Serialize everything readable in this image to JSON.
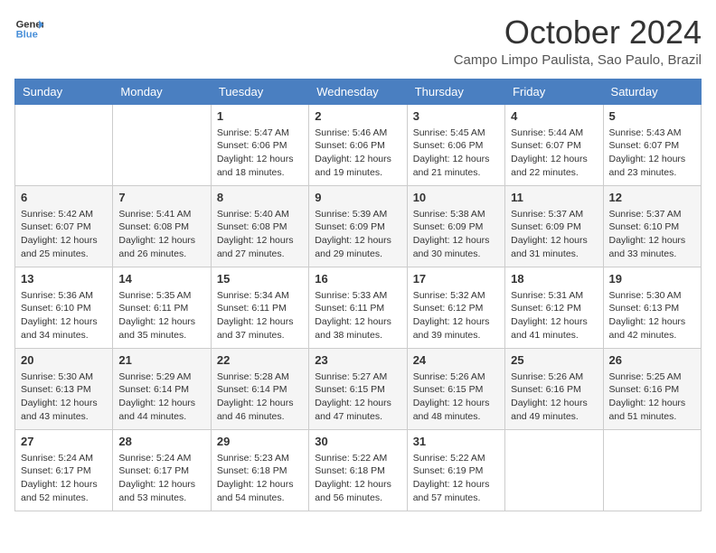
{
  "logo": {
    "line1": "General",
    "line2": "Blue"
  },
  "title": "October 2024",
  "location": "Campo Limpo Paulista, Sao Paulo, Brazil",
  "headers": [
    "Sunday",
    "Monday",
    "Tuesday",
    "Wednesday",
    "Thursday",
    "Friday",
    "Saturday"
  ],
  "weeks": [
    [
      {
        "day": "",
        "content": ""
      },
      {
        "day": "",
        "content": ""
      },
      {
        "day": "1",
        "content": "Sunrise: 5:47 AM\nSunset: 6:06 PM\nDaylight: 12 hours and 18 minutes."
      },
      {
        "day": "2",
        "content": "Sunrise: 5:46 AM\nSunset: 6:06 PM\nDaylight: 12 hours and 19 minutes."
      },
      {
        "day": "3",
        "content": "Sunrise: 5:45 AM\nSunset: 6:06 PM\nDaylight: 12 hours and 21 minutes."
      },
      {
        "day": "4",
        "content": "Sunrise: 5:44 AM\nSunset: 6:07 PM\nDaylight: 12 hours and 22 minutes."
      },
      {
        "day": "5",
        "content": "Sunrise: 5:43 AM\nSunset: 6:07 PM\nDaylight: 12 hours and 23 minutes."
      }
    ],
    [
      {
        "day": "6",
        "content": "Sunrise: 5:42 AM\nSunset: 6:07 PM\nDaylight: 12 hours and 25 minutes."
      },
      {
        "day": "7",
        "content": "Sunrise: 5:41 AM\nSunset: 6:08 PM\nDaylight: 12 hours and 26 minutes."
      },
      {
        "day": "8",
        "content": "Sunrise: 5:40 AM\nSunset: 6:08 PM\nDaylight: 12 hours and 27 minutes."
      },
      {
        "day": "9",
        "content": "Sunrise: 5:39 AM\nSunset: 6:09 PM\nDaylight: 12 hours and 29 minutes."
      },
      {
        "day": "10",
        "content": "Sunrise: 5:38 AM\nSunset: 6:09 PM\nDaylight: 12 hours and 30 minutes."
      },
      {
        "day": "11",
        "content": "Sunrise: 5:37 AM\nSunset: 6:09 PM\nDaylight: 12 hours and 31 minutes."
      },
      {
        "day": "12",
        "content": "Sunrise: 5:37 AM\nSunset: 6:10 PM\nDaylight: 12 hours and 33 minutes."
      }
    ],
    [
      {
        "day": "13",
        "content": "Sunrise: 5:36 AM\nSunset: 6:10 PM\nDaylight: 12 hours and 34 minutes."
      },
      {
        "day": "14",
        "content": "Sunrise: 5:35 AM\nSunset: 6:11 PM\nDaylight: 12 hours and 35 minutes."
      },
      {
        "day": "15",
        "content": "Sunrise: 5:34 AM\nSunset: 6:11 PM\nDaylight: 12 hours and 37 minutes."
      },
      {
        "day": "16",
        "content": "Sunrise: 5:33 AM\nSunset: 6:11 PM\nDaylight: 12 hours and 38 minutes."
      },
      {
        "day": "17",
        "content": "Sunrise: 5:32 AM\nSunset: 6:12 PM\nDaylight: 12 hours and 39 minutes."
      },
      {
        "day": "18",
        "content": "Sunrise: 5:31 AM\nSunset: 6:12 PM\nDaylight: 12 hours and 41 minutes."
      },
      {
        "day": "19",
        "content": "Sunrise: 5:30 AM\nSunset: 6:13 PM\nDaylight: 12 hours and 42 minutes."
      }
    ],
    [
      {
        "day": "20",
        "content": "Sunrise: 5:30 AM\nSunset: 6:13 PM\nDaylight: 12 hours and 43 minutes."
      },
      {
        "day": "21",
        "content": "Sunrise: 5:29 AM\nSunset: 6:14 PM\nDaylight: 12 hours and 44 minutes."
      },
      {
        "day": "22",
        "content": "Sunrise: 5:28 AM\nSunset: 6:14 PM\nDaylight: 12 hours and 46 minutes."
      },
      {
        "day": "23",
        "content": "Sunrise: 5:27 AM\nSunset: 6:15 PM\nDaylight: 12 hours and 47 minutes."
      },
      {
        "day": "24",
        "content": "Sunrise: 5:26 AM\nSunset: 6:15 PM\nDaylight: 12 hours and 48 minutes."
      },
      {
        "day": "25",
        "content": "Sunrise: 5:26 AM\nSunset: 6:16 PM\nDaylight: 12 hours and 49 minutes."
      },
      {
        "day": "26",
        "content": "Sunrise: 5:25 AM\nSunset: 6:16 PM\nDaylight: 12 hours and 51 minutes."
      }
    ],
    [
      {
        "day": "27",
        "content": "Sunrise: 5:24 AM\nSunset: 6:17 PM\nDaylight: 12 hours and 52 minutes."
      },
      {
        "day": "28",
        "content": "Sunrise: 5:24 AM\nSunset: 6:17 PM\nDaylight: 12 hours and 53 minutes."
      },
      {
        "day": "29",
        "content": "Sunrise: 5:23 AM\nSunset: 6:18 PM\nDaylight: 12 hours and 54 minutes."
      },
      {
        "day": "30",
        "content": "Sunrise: 5:22 AM\nSunset: 6:18 PM\nDaylight: 12 hours and 56 minutes."
      },
      {
        "day": "31",
        "content": "Sunrise: 5:22 AM\nSunset: 6:19 PM\nDaylight: 12 hours and 57 minutes."
      },
      {
        "day": "",
        "content": ""
      },
      {
        "day": "",
        "content": ""
      }
    ]
  ]
}
